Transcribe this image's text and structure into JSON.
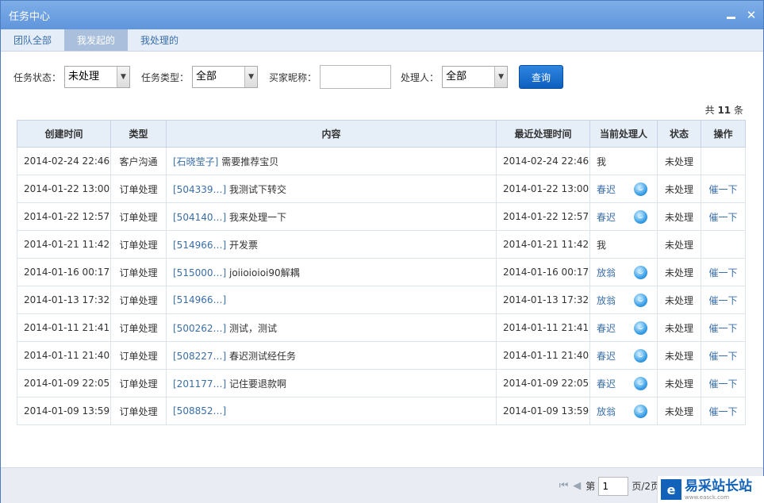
{
  "window": {
    "title": "任务中心"
  },
  "tabs": [
    {
      "label": "团队全部",
      "active": false
    },
    {
      "label": "我发起的",
      "active": true
    },
    {
      "label": "我处理的",
      "active": false
    }
  ],
  "filters": {
    "status_label": "任务状态：",
    "status_value": "未处理",
    "type_label": "任务类型：",
    "type_value": "全部",
    "nickname_label": "买家昵称：",
    "nickname_value": "",
    "handler_label": "处理人：",
    "handler_value": "全部",
    "query_button": "查询"
  },
  "summary": {
    "prefix": "共",
    "count": "11",
    "suffix": "条"
  },
  "table": {
    "headers": [
      "创建时间",
      "类型",
      "内容",
      "最近处理时间",
      "当前处理人",
      "状态",
      "操作"
    ],
    "rows": [
      {
        "created": "2014-02-24 22:46",
        "type": "客户沟通",
        "ref": "[石晓莹子]",
        "text": "需要推荐宝贝",
        "last": "2014-02-24 22:46",
        "handler": "我",
        "handler_link": false,
        "chat": false,
        "status": "未处理",
        "action": ""
      },
      {
        "created": "2014-01-22 13:00",
        "type": "订单处理",
        "ref": "[504339…]",
        "text": "我测试下转交",
        "last": "2014-01-22 13:00",
        "handler": "春迟",
        "handler_link": true,
        "chat": true,
        "status": "未处理",
        "action": "催一下"
      },
      {
        "created": "2014-01-22 12:57",
        "type": "订单处理",
        "ref": "[504140…]",
        "text": "我来处理一下",
        "last": "2014-01-22 12:57",
        "handler": "春迟",
        "handler_link": true,
        "chat": true,
        "status": "未处理",
        "action": "催一下"
      },
      {
        "created": "2014-01-21 11:42",
        "type": "订单处理",
        "ref": "[514966…]",
        "text": "开发票",
        "last": "2014-01-21 11:42",
        "handler": "我",
        "handler_link": false,
        "chat": false,
        "status": "未处理",
        "action": ""
      },
      {
        "created": "2014-01-16 00:17",
        "type": "订单处理",
        "ref": "[515000…]",
        "text": "joiioioioi90解耦",
        "last": "2014-01-16 00:17",
        "handler": "放翁",
        "handler_link": true,
        "chat": true,
        "status": "未处理",
        "action": "催一下"
      },
      {
        "created": "2014-01-13 17:32",
        "type": "订单处理",
        "ref": "[514966…]",
        "text": "",
        "last": "2014-01-13 17:32",
        "handler": "放翁",
        "handler_link": true,
        "chat": true,
        "status": "未处理",
        "action": "催一下"
      },
      {
        "created": "2014-01-11 21:41",
        "type": "订单处理",
        "ref": "[500262…]",
        "text": "测试，测试",
        "last": "2014-01-11 21:41",
        "handler": "春迟",
        "handler_link": true,
        "chat": true,
        "status": "未处理",
        "action": "催一下"
      },
      {
        "created": "2014-01-11 21:40",
        "type": "订单处理",
        "ref": "[508227…]",
        "text": "春迟测试经任务",
        "last": "2014-01-11 21:40",
        "handler": "春迟",
        "handler_link": true,
        "chat": true,
        "status": "未处理",
        "action": "催一下"
      },
      {
        "created": "2014-01-09 22:05",
        "type": "订单处理",
        "ref": "[201177…]",
        "text": "记住要退款啊",
        "last": "2014-01-09 22:05",
        "handler": "春迟",
        "handler_link": true,
        "chat": true,
        "status": "未处理",
        "action": "催一下"
      },
      {
        "created": "2014-01-09 13:59",
        "type": "订单处理",
        "ref": "[508852…]",
        "text": "",
        "last": "2014-01-09 13:59",
        "handler": "放翁",
        "handler_link": true,
        "chat": true,
        "status": "未处理",
        "action": "催一下"
      }
    ]
  },
  "pagination": {
    "page_prefix": "第",
    "page_value": "1",
    "page_suffix": "页/2页"
  },
  "watermark": {
    "name": "易采站长站",
    "url_text": "www.easck.com"
  },
  "colors": {
    "titlebar": "#6a9ee0",
    "link": "#3a6ea8",
    "query_button": "#1668c8"
  }
}
